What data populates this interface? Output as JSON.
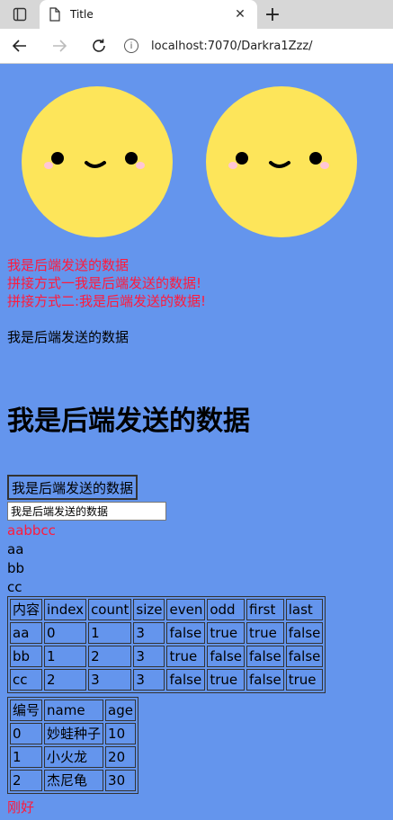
{
  "browser": {
    "tab_title": "Title",
    "url": "localhost:7070/Darkra1Zzz/"
  },
  "content": {
    "red_lines": [
      "我是后端发送的数据",
      "拼接方式一我是后端发送的数据!",
      "拼接方式二:我是后端发送的数据!"
    ],
    "plain_text": "我是后端发送的数据",
    "heading": "我是后端发送的数据",
    "button_label": "我是后端发送的数据",
    "input_value": "我是后端发送的数据",
    "red_concat": "aabbcc",
    "list_items": [
      "aa",
      "bb",
      "cc"
    ],
    "status_table": {
      "headers": [
        "内容",
        "index",
        "count",
        "size",
        "even",
        "odd",
        "first",
        "last"
      ],
      "rows": [
        [
          "aa",
          "0",
          "1",
          "3",
          "false",
          "true",
          "true",
          "false"
        ],
        [
          "bb",
          "1",
          "2",
          "3",
          "true",
          "false",
          "false",
          "false"
        ],
        [
          "cc",
          "2",
          "3",
          "3",
          "false",
          "true",
          "false",
          "true"
        ]
      ]
    },
    "user_table": {
      "headers": [
        "编号",
        "name",
        "age"
      ],
      "rows": [
        [
          "0",
          "妙蛙种子",
          "10"
        ],
        [
          "1",
          "小火龙",
          "20"
        ],
        [
          "2",
          "杰尼龟",
          "30"
        ]
      ]
    },
    "footer_red": "刚好"
  },
  "colors": {
    "page_bg": "#6495ed",
    "red_text": "#ff1a3c",
    "face_yellow": "#fde55a"
  }
}
